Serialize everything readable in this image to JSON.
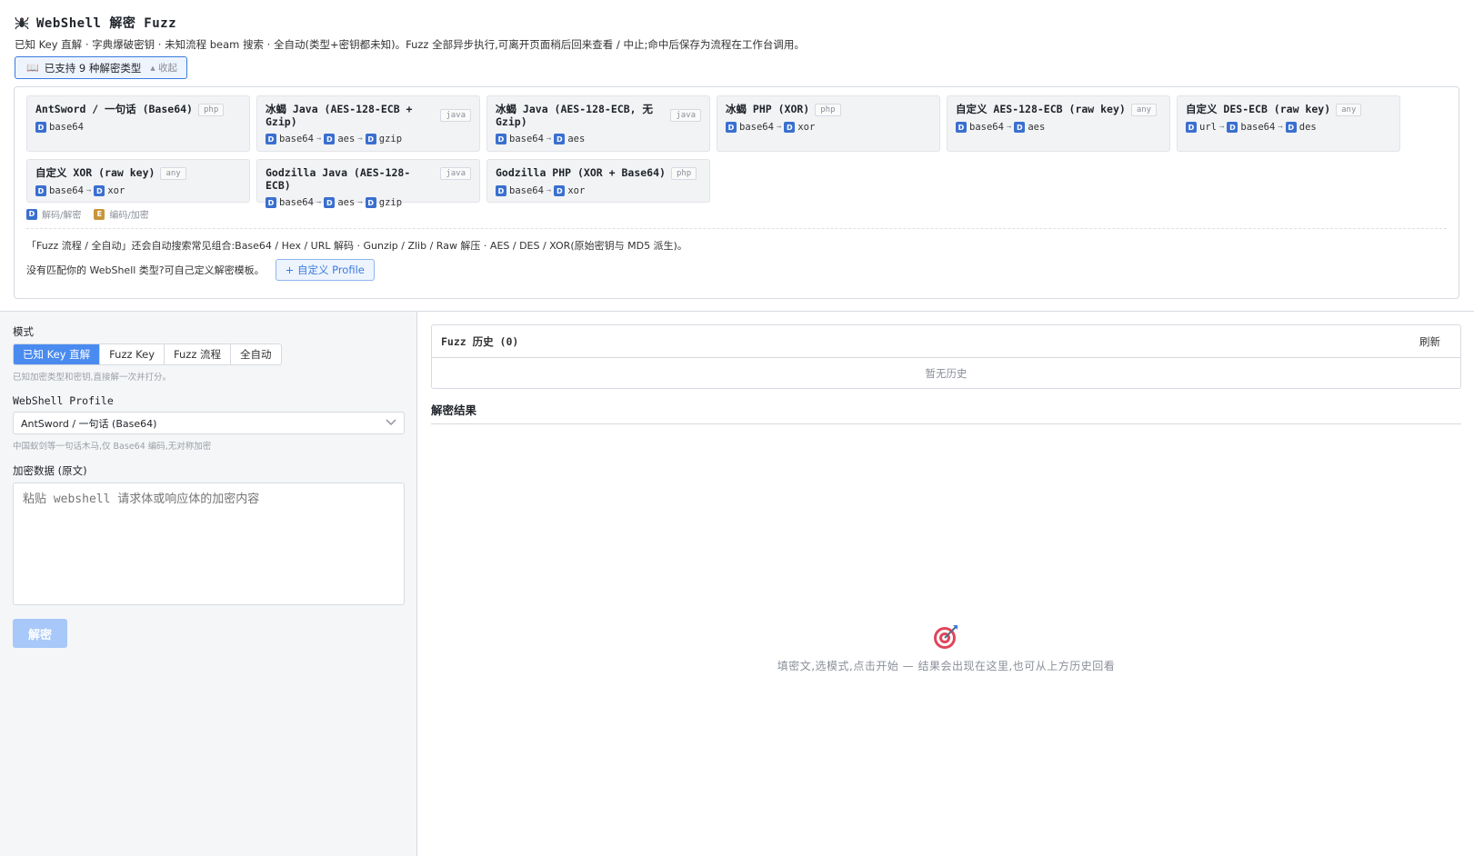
{
  "header": {
    "title": "WebShell 解密 Fuzz",
    "subtitle": "已知 Key 直解 · 字典爆破密钥 · 未知流程 beam 搜索 · 全自动(类型+密钥都未知)。Fuzz 全部异步执行,可离开页面稍后回来查看 / 中止;命中后保存为流程在工作台调用。",
    "support_label": "已支持 9 种解密类型",
    "collapse_label": "▴ 收起"
  },
  "profiles": [
    {
      "title": "AntSword / 一句话 (Base64)",
      "lang": "php",
      "chain": [
        "base64"
      ]
    },
    {
      "title": "冰蝎 Java (AES-128-ECB + Gzip)",
      "lang": "java",
      "chain": [
        "base64",
        "aes",
        "gzip"
      ]
    },
    {
      "title": "冰蝎 Java (AES-128-ECB, 无 Gzip)",
      "lang": "java",
      "chain": [
        "base64",
        "aes"
      ]
    },
    {
      "title": "冰蝎 PHP (XOR)",
      "lang": "php",
      "chain": [
        "base64",
        "xor"
      ]
    },
    {
      "title": "自定义 AES-128-ECB (raw key)",
      "lang": "any",
      "chain": [
        "base64",
        "aes"
      ]
    },
    {
      "title": "自定义 DES-ECB (raw key)",
      "lang": "any",
      "chain": [
        "url",
        "base64",
        "des"
      ]
    },
    {
      "title": "自定义 XOR (raw key)",
      "lang": "any",
      "chain": [
        "base64",
        "xor"
      ]
    },
    {
      "title": "Godzilla Java (AES-128-ECB)",
      "lang": "java",
      "chain": [
        "base64",
        "aes",
        "gzip"
      ]
    },
    {
      "title": "Godzilla PHP (XOR + Base64)",
      "lang": "php",
      "chain": [
        "base64",
        "xor"
      ]
    }
  ],
  "legend": {
    "decode_badge": "D",
    "decode_label": "解码/解密",
    "encode_badge": "E",
    "encode_label": "编码/加密"
  },
  "fuzz_note": "「Fuzz 流程 / 全自动」还会自动搜索常见组合:Base64 / Hex / URL 解码 · Gunzip / Zlib / Raw 解压 · AES / DES / XOR(原始密钥与 MD5 派生)。",
  "custom": {
    "prompt": "没有匹配你的 WebShell 类型?可自己定义解密模板。",
    "button": "+ 自定义 Profile"
  },
  "form": {
    "mode_label": "模式",
    "modes": [
      "已知 Key 直解",
      "Fuzz Key",
      "Fuzz 流程",
      "全自动"
    ],
    "active_mode": 0,
    "mode_hint": "已知加密类型和密钥,直接解一次并打分。",
    "profile_label": "WebShell Profile",
    "profile_value": "AntSword / 一句话 (Base64)",
    "profile_hint": "中国蚁剑等一句话木马,仅 Base64 编码,无对称加密",
    "data_label": "加密数据 (原文)",
    "data_placeholder": "粘贴 webshell 请求体或响应体的加密内容",
    "decrypt_button": "解密"
  },
  "history": {
    "title": "Fuzz 历史 (0)",
    "refresh": "刷新",
    "empty": "暂无历史"
  },
  "results": {
    "title": "解密结果",
    "empty_text": "填密文,选模式,点击开始 — 结果会出现在这里,也可从上方历史回看"
  },
  "colors": {
    "accent": "#3a7be0",
    "badge_decode": "#3a6fd0",
    "badge_encode": "#c9953a",
    "disabled_button": "#a7c8f8"
  },
  "icons": {
    "title": "spider-icon",
    "support": "book-icon",
    "select": "chevron-down-icon",
    "empty": "target-icon"
  }
}
